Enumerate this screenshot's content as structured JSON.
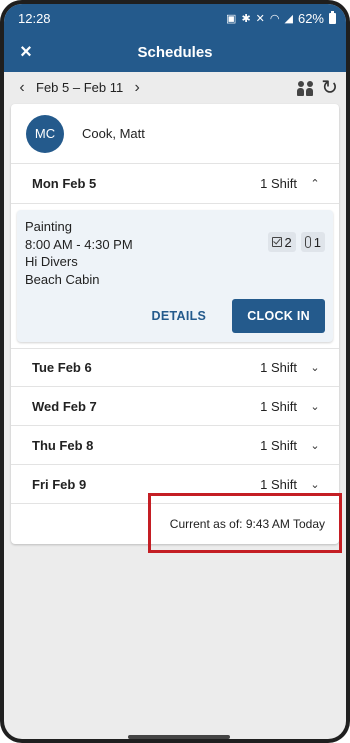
{
  "status_bar": {
    "time": "12:28",
    "icons": [
      "photo-icon",
      "bluetooth-icon",
      "mute-icon",
      "wifi-icon",
      "signal-icon"
    ],
    "battery": "62%"
  },
  "app_bar": {
    "close_icon": "×",
    "title": "Schedules"
  },
  "week_nav": {
    "prev_icon": "‹",
    "range": "Feb 5 – Feb 11",
    "next_icon": "›",
    "refresh_icon": "↻"
  },
  "user": {
    "initials": "MC",
    "name": "Cook, Matt"
  },
  "days": [
    {
      "label": "Mon Feb 5",
      "shift_count": "1 Shift",
      "expanded": true,
      "shift": {
        "job": "Painting",
        "time": "8:00 AM - 4:30 PM",
        "customer": "Hi Divers",
        "location": "Beach Cabin",
        "tasks_count": "2",
        "attachments_count": "1",
        "details_label": "DETAILS",
        "clock_in_label": "CLOCK IN"
      }
    },
    {
      "label": "Tue Feb 6",
      "shift_count": "1 Shift",
      "expanded": false
    },
    {
      "label": "Wed Feb 7",
      "shift_count": "1 Shift",
      "expanded": false
    },
    {
      "label": "Thu Feb 8",
      "shift_count": "1 Shift",
      "expanded": false
    },
    {
      "label": "Fri Feb 9",
      "shift_count": "1 Shift",
      "expanded": false
    }
  ],
  "chevrons": {
    "up": "⌃",
    "down": "⌄"
  },
  "footer": {
    "current_as_of": "Current as of: 9:43 AM Today"
  },
  "colors": {
    "primary": "#245a8c",
    "highlight": "#c41e24",
    "panel": "#eef3f8",
    "background": "#ececec"
  }
}
